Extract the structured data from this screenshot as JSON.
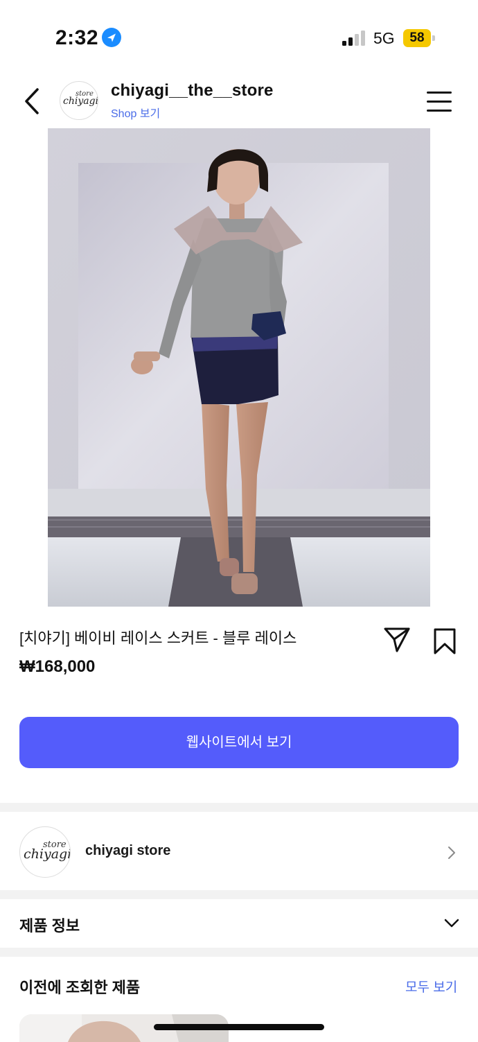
{
  "status_bar": {
    "time": "2:32",
    "network": "5G",
    "battery": "58",
    "location_icon": "location-arrow-icon",
    "signal_icon": "cellular-signal-icon",
    "battery_color": "#f5c800"
  },
  "header": {
    "back_icon": "chevron-left-icon",
    "shop_name": "chiyagi__the__store",
    "shop_link": "Shop 보기",
    "menu_icon": "hamburger-menu-icon",
    "logo": {
      "small": "store",
      "main": "chiyagi"
    }
  },
  "product": {
    "title": "[치야기] 베이비 레이스 스커트 - 블루 레이스",
    "price": "₩168,000",
    "share_icon": "paper-plane-icon",
    "bookmark_icon": "bookmark-icon"
  },
  "cta": {
    "label": "웹사이트에서 보기",
    "color": "#545cfb"
  },
  "store_row": {
    "name": "chiyagi store",
    "chevron_icon": "chevron-right-icon"
  },
  "product_info": {
    "label": "제품 정보",
    "chevron_icon": "chevron-down-icon"
  },
  "recent": {
    "label": "이전에 조회한 제품",
    "view_all": "모두 보기"
  },
  "accent_color": "#4a6ce8"
}
